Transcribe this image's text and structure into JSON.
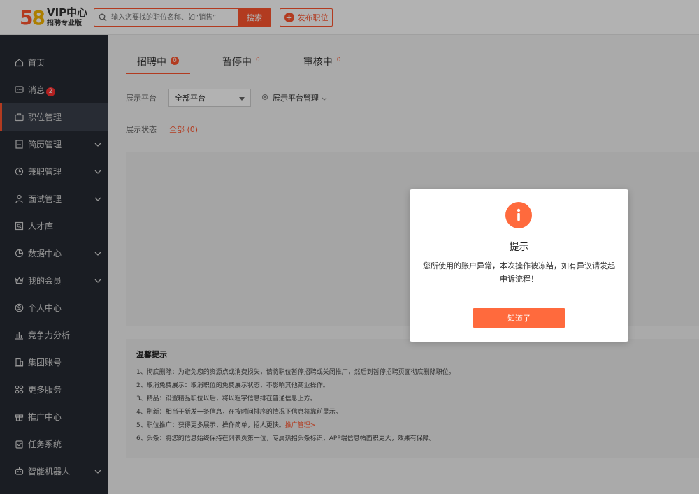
{
  "header": {
    "logo_number": "58",
    "logo_title": "VIP中心",
    "logo_subtitle": "招聘专业版",
    "search_placeholder": "输入您要找的职位名称、如“销售”",
    "search_button": "搜索",
    "publish_button": "发布职位"
  },
  "sidebar": {
    "items": [
      {
        "label": "首页",
        "icon": "home-icon"
      },
      {
        "label": "消息",
        "icon": "message-icon",
        "badge": "2"
      },
      {
        "label": "职位管理",
        "icon": "briefcase-icon",
        "active": true
      },
      {
        "label": "简历管理",
        "icon": "resume-icon",
        "expandable": true
      },
      {
        "label": "兼职管理",
        "icon": "clock-icon",
        "expandable": true
      },
      {
        "label": "面试管理",
        "icon": "person-icon",
        "expandable": true
      },
      {
        "label": "人才库",
        "icon": "talent-icon"
      },
      {
        "label": "数据中心",
        "icon": "chart-icon",
        "expandable": true
      },
      {
        "label": "我的会员",
        "icon": "crown-icon",
        "expandable": true
      },
      {
        "label": "个人中心",
        "icon": "user-icon"
      },
      {
        "label": "竞争力分析",
        "icon": "bar-chart-icon"
      },
      {
        "label": "集团账号",
        "icon": "building-icon"
      },
      {
        "label": "更多服务",
        "icon": "grid-icon"
      },
      {
        "label": "推广中心",
        "icon": "gift-icon"
      },
      {
        "label": "任务系统",
        "icon": "task-icon"
      },
      {
        "label": "智能机器人",
        "icon": "robot-icon",
        "expandable": true
      }
    ]
  },
  "main": {
    "tabs": [
      {
        "label": "招聘中",
        "count": "0",
        "active": true
      },
      {
        "label": "暂停中",
        "count": "0"
      },
      {
        "label": "审核中",
        "count": "0"
      }
    ],
    "platform_label": "展示平台",
    "platform_value": "全部平台",
    "platform_manage": "展示平台管理",
    "status_label": "展示状态",
    "status_value": "全部 (0)",
    "tips": {
      "title": "温馨提示",
      "lines": [
        "1、彻底删除：为避免您的资源点或消费损失，请将职位暂停招聘或关闭推广，然后到暂停招聘页面彻底删除职位。",
        "2、取消免费展示：取消职位的免费展示状态，不影响其他商业操作。",
        "3、精品：设置精品职位以后，将以粗字信息排在普通信息上方。",
        "4、刷新：相当于新发一条信息，在按时间排序的情况下信息将靠前显示。",
        "5、职位推广：获得更多展示，操作简单，招人更快。",
        "6、头条：将您的信息始终保持在列表页第一位，专属热招头条标识，APP端信息帖面积更大，效果有保障。"
      ],
      "promo_link": "推广管理>"
    }
  },
  "modal": {
    "title": "提示",
    "message": "您所使用的账户异常，本次操作被冻结，如有异议请发起申诉流程！",
    "button": "知道了",
    "accent_color": "#ff6a3d"
  }
}
